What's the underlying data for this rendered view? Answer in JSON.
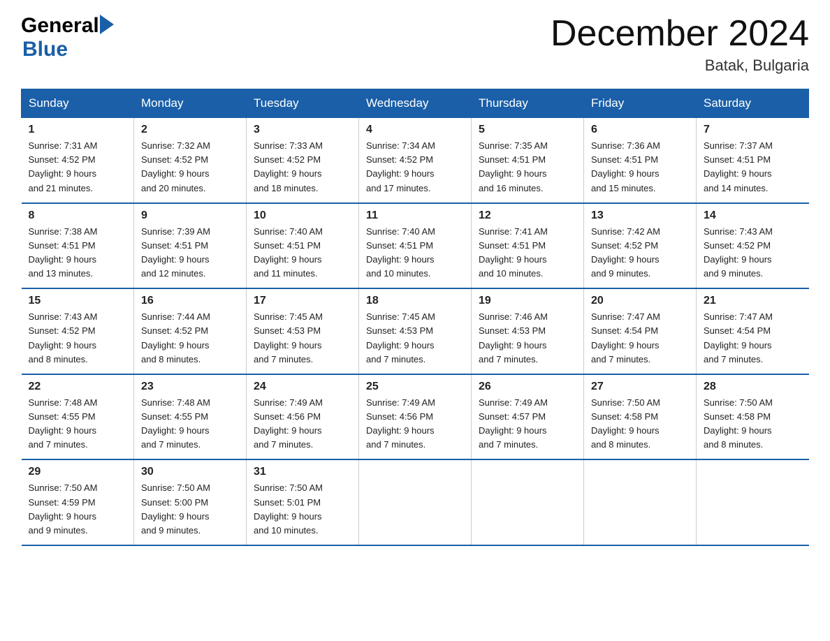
{
  "header": {
    "logo_general": "General",
    "logo_blue": "Blue",
    "title": "December 2024",
    "location": "Batak, Bulgaria"
  },
  "weekdays": [
    "Sunday",
    "Monday",
    "Tuesday",
    "Wednesday",
    "Thursday",
    "Friday",
    "Saturday"
  ],
  "weeks": [
    [
      {
        "day": "1",
        "sunrise": "7:31 AM",
        "sunset": "4:52 PM",
        "daylight": "9 hours and 21 minutes."
      },
      {
        "day": "2",
        "sunrise": "7:32 AM",
        "sunset": "4:52 PM",
        "daylight": "9 hours and 20 minutes."
      },
      {
        "day": "3",
        "sunrise": "7:33 AM",
        "sunset": "4:52 PM",
        "daylight": "9 hours and 18 minutes."
      },
      {
        "day": "4",
        "sunrise": "7:34 AM",
        "sunset": "4:52 PM",
        "daylight": "9 hours and 17 minutes."
      },
      {
        "day": "5",
        "sunrise": "7:35 AM",
        "sunset": "4:51 PM",
        "daylight": "9 hours and 16 minutes."
      },
      {
        "day": "6",
        "sunrise": "7:36 AM",
        "sunset": "4:51 PM",
        "daylight": "9 hours and 15 minutes."
      },
      {
        "day": "7",
        "sunrise": "7:37 AM",
        "sunset": "4:51 PM",
        "daylight": "9 hours and 14 minutes."
      }
    ],
    [
      {
        "day": "8",
        "sunrise": "7:38 AM",
        "sunset": "4:51 PM",
        "daylight": "9 hours and 13 minutes."
      },
      {
        "day": "9",
        "sunrise": "7:39 AM",
        "sunset": "4:51 PM",
        "daylight": "9 hours and 12 minutes."
      },
      {
        "day": "10",
        "sunrise": "7:40 AM",
        "sunset": "4:51 PM",
        "daylight": "9 hours and 11 minutes."
      },
      {
        "day": "11",
        "sunrise": "7:40 AM",
        "sunset": "4:51 PM",
        "daylight": "9 hours and 10 minutes."
      },
      {
        "day": "12",
        "sunrise": "7:41 AM",
        "sunset": "4:51 PM",
        "daylight": "9 hours and 10 minutes."
      },
      {
        "day": "13",
        "sunrise": "7:42 AM",
        "sunset": "4:52 PM",
        "daylight": "9 hours and 9 minutes."
      },
      {
        "day": "14",
        "sunrise": "7:43 AM",
        "sunset": "4:52 PM",
        "daylight": "9 hours and 9 minutes."
      }
    ],
    [
      {
        "day": "15",
        "sunrise": "7:43 AM",
        "sunset": "4:52 PM",
        "daylight": "9 hours and 8 minutes."
      },
      {
        "day": "16",
        "sunrise": "7:44 AM",
        "sunset": "4:52 PM",
        "daylight": "9 hours and 8 minutes."
      },
      {
        "day": "17",
        "sunrise": "7:45 AM",
        "sunset": "4:53 PM",
        "daylight": "9 hours and 7 minutes."
      },
      {
        "day": "18",
        "sunrise": "7:45 AM",
        "sunset": "4:53 PM",
        "daylight": "9 hours and 7 minutes."
      },
      {
        "day": "19",
        "sunrise": "7:46 AM",
        "sunset": "4:53 PM",
        "daylight": "9 hours and 7 minutes."
      },
      {
        "day": "20",
        "sunrise": "7:47 AM",
        "sunset": "4:54 PM",
        "daylight": "9 hours and 7 minutes."
      },
      {
        "day": "21",
        "sunrise": "7:47 AM",
        "sunset": "4:54 PM",
        "daylight": "9 hours and 7 minutes."
      }
    ],
    [
      {
        "day": "22",
        "sunrise": "7:48 AM",
        "sunset": "4:55 PM",
        "daylight": "9 hours and 7 minutes."
      },
      {
        "day": "23",
        "sunrise": "7:48 AM",
        "sunset": "4:55 PM",
        "daylight": "9 hours and 7 minutes."
      },
      {
        "day": "24",
        "sunrise": "7:49 AM",
        "sunset": "4:56 PM",
        "daylight": "9 hours and 7 minutes."
      },
      {
        "day": "25",
        "sunrise": "7:49 AM",
        "sunset": "4:56 PM",
        "daylight": "9 hours and 7 minutes."
      },
      {
        "day": "26",
        "sunrise": "7:49 AM",
        "sunset": "4:57 PM",
        "daylight": "9 hours and 7 minutes."
      },
      {
        "day": "27",
        "sunrise": "7:50 AM",
        "sunset": "4:58 PM",
        "daylight": "9 hours and 8 minutes."
      },
      {
        "day": "28",
        "sunrise": "7:50 AM",
        "sunset": "4:58 PM",
        "daylight": "9 hours and 8 minutes."
      }
    ],
    [
      {
        "day": "29",
        "sunrise": "7:50 AM",
        "sunset": "4:59 PM",
        "daylight": "9 hours and 9 minutes."
      },
      {
        "day": "30",
        "sunrise": "7:50 AM",
        "sunset": "5:00 PM",
        "daylight": "9 hours and 9 minutes."
      },
      {
        "day": "31",
        "sunrise": "7:50 AM",
        "sunset": "5:01 PM",
        "daylight": "9 hours and 10 minutes."
      },
      null,
      null,
      null,
      null
    ]
  ],
  "labels": {
    "sunrise": "Sunrise:",
    "sunset": "Sunset:",
    "daylight": "Daylight:"
  }
}
